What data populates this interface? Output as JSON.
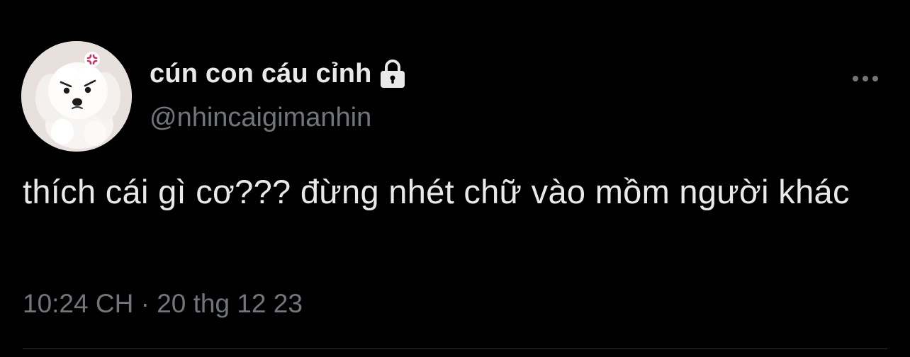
{
  "tweet": {
    "author": {
      "display_name": "cún con cáu cỉnh",
      "handle": "@nhincaigimanhin",
      "protected_icon": "lock-icon",
      "avatar_icon": "white-puppy-avatar"
    },
    "text": "thích cái gì cơ??? đừng nhét chữ vào mồm người khác",
    "time": "10:24 CH",
    "separator": "·",
    "date": "20 thg 12 23",
    "more_icon": "more-horizontal-icon"
  },
  "colors": {
    "background": "#000000",
    "primary_text": "#e7e9ea",
    "secondary_text": "#71767b",
    "divider": "#2f3336"
  }
}
